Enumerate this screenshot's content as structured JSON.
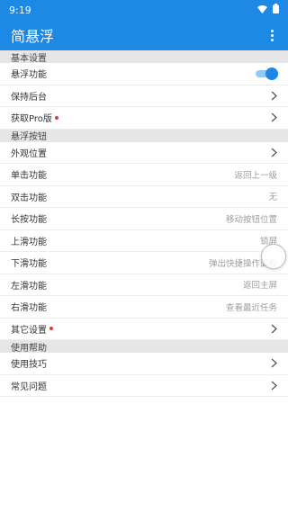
{
  "status": {
    "time": "9:19"
  },
  "app": {
    "title": "简悬浮"
  },
  "colors": {
    "primary": "#1e88e5",
    "badge": "#e53935"
  },
  "sections": {
    "basic": {
      "header": "基本设置",
      "float_func": "悬浮功能",
      "keep_bg": "保持后台",
      "get_pro": "获取Pro版"
    },
    "button": {
      "header": "悬浮按钮",
      "appearance": "外观位置",
      "single": {
        "label": "单击功能",
        "value": "返回上一级"
      },
      "double": {
        "label": "双击功能",
        "value": "无"
      },
      "long": {
        "label": "长按功能",
        "value": "移动按钮位置"
      },
      "up": {
        "label": "上滑功能",
        "value": "锁屏"
      },
      "down": {
        "label": "下滑功能",
        "value": "弹出快捷操作面板"
      },
      "left": {
        "label": "左滑功能",
        "value": "返回主屏"
      },
      "right": {
        "label": "右滑功能",
        "value": "查看最近任务"
      },
      "other": "其它设置"
    },
    "help": {
      "header": "使用帮助",
      "tips": "使用技巧",
      "faq": "常见问题"
    }
  },
  "toggles": {
    "float_enabled": true
  },
  "icons": {
    "wifi": "wifi-icon",
    "battery": "battery-icon",
    "chevron": "chevron-right-icon",
    "more": "more-vert-icon"
  }
}
